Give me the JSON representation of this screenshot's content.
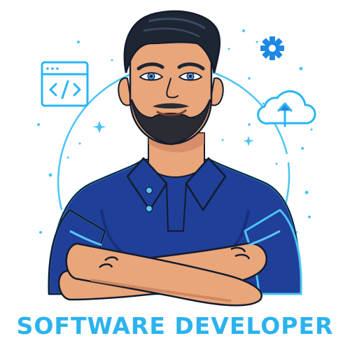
{
  "caption": {
    "text": "SOFTWARE DEVELOPER"
  },
  "icons": {
    "browser": "code-window-icon",
    "gear": "gear-icon",
    "cloud": "cloud-upload-icon"
  },
  "colors": {
    "accent": "#29b6f6",
    "caption_text": "#2ab3ee",
    "shirt": "#1f3f99",
    "shirt_dark": "#172f7a",
    "button": "#5ec6f5",
    "skin": "#e9a67b",
    "skin_shadow": "#c9805b",
    "hair": "#1e2633",
    "beard": "#2a2b33",
    "outline": "#141b2c",
    "eye": "#4f8fd8"
  }
}
